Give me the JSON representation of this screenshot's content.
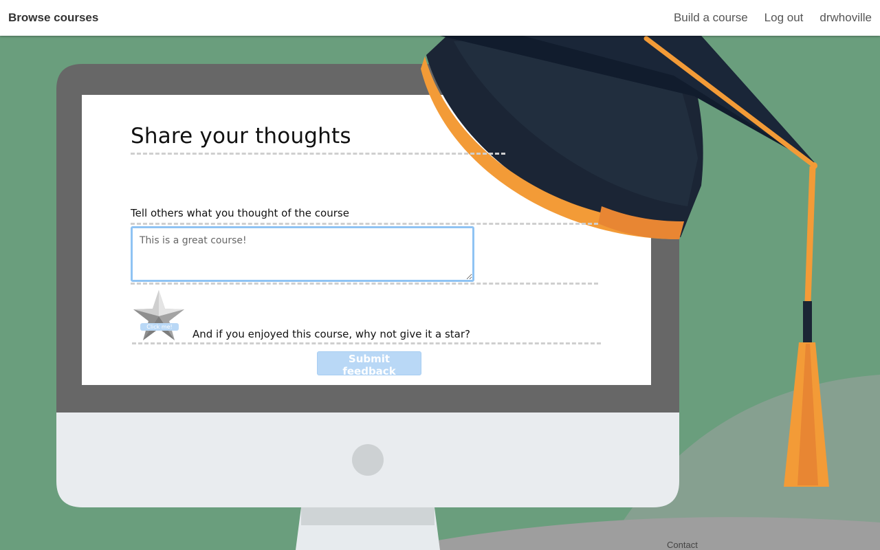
{
  "navbar": {
    "brand": "Browse courses",
    "links": [
      "Build a course",
      "Log out",
      "drwhoville"
    ]
  },
  "form": {
    "title": "Share your thoughts",
    "feedback_label": "Tell others what you thought of the course",
    "feedback_placeholder": "This is a great course!",
    "feedback_value": "",
    "star_badge": "Click me!",
    "star_question": "And if you enjoyed this course, why not give it a star?",
    "submit_label": "Submit feedback"
  },
  "footer": {
    "contact": "Contact"
  },
  "colors": {
    "background": "#6a9e7d",
    "accent": "#8fc3f3",
    "button_disabled": "#b9d8f6",
    "cap_dark": "#1d2a3c",
    "cap_orange": "#f39b37"
  },
  "icons": {
    "star": "star-icon",
    "monitor": "monitor-illustration",
    "graduation_cap": "graduation-cap-illustration"
  }
}
